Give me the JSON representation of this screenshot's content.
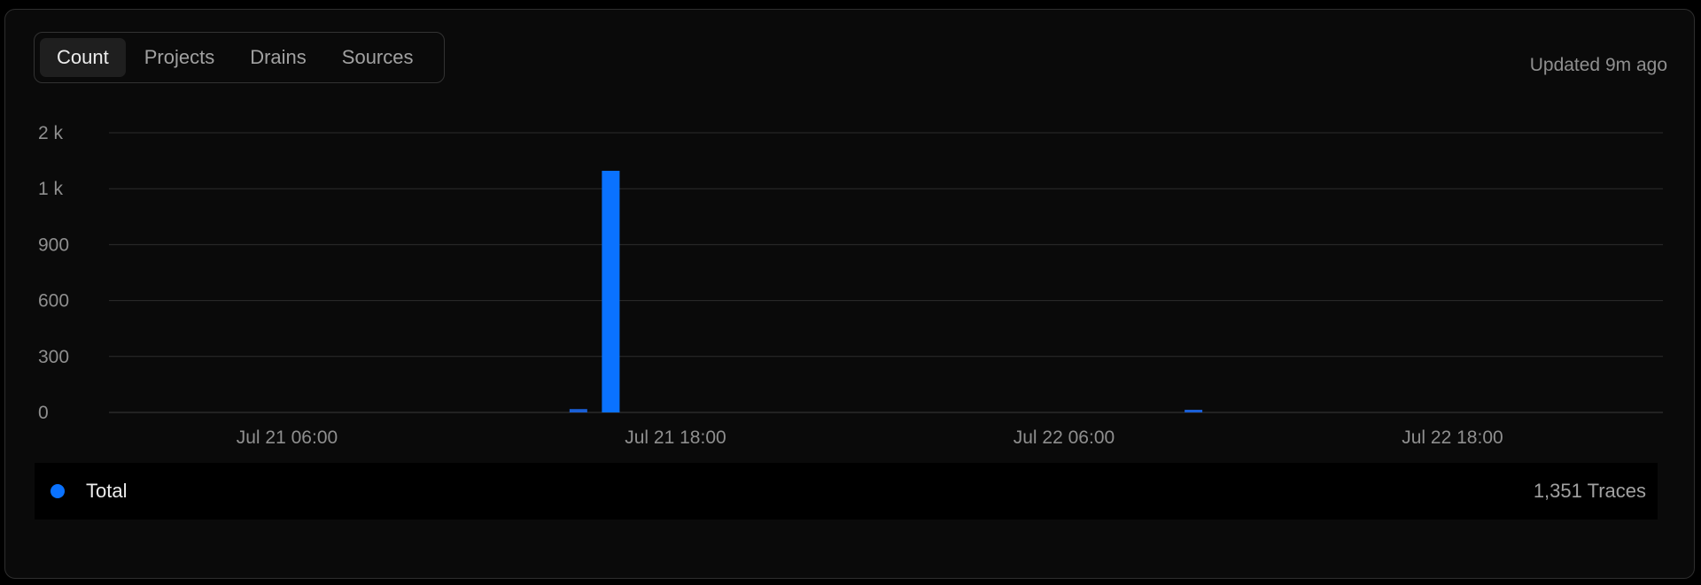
{
  "tabs": [
    {
      "label": "Count",
      "active": true
    },
    {
      "label": "Projects",
      "active": false
    },
    {
      "label": "Drains",
      "active": false
    },
    {
      "label": "Sources",
      "active": false
    }
  ],
  "updated_text": "Updated 9m ago",
  "legend": {
    "label": "Total",
    "value": "1,351 Traces",
    "color": "#0a72ff"
  },
  "chart_data": {
    "type": "bar",
    "title": "",
    "xlabel": "",
    "ylabel": "",
    "y_ticks": [
      "0",
      "300",
      "600",
      "900",
      "1 k",
      "2 k"
    ],
    "x_ticks": [
      {
        "label": "Jul 21 06:00",
        "hour": 6
      },
      {
        "label": "Jul 21 18:00",
        "hour": 18
      },
      {
        "label": "Jul 22 06:00",
        "hour": 30
      },
      {
        "label": "Jul 22 18:00",
        "hour": 42
      }
    ],
    "x_range_hours": [
      0.5,
      48.5
    ],
    "series": [
      {
        "name": "Total",
        "color": "#0a72ff",
        "points": [
          {
            "hour": 15,
            "value": 18
          },
          {
            "hour": 16,
            "value": 1320
          },
          {
            "hour": 34,
            "value": 13
          }
        ]
      }
    ],
    "grid": true
  }
}
